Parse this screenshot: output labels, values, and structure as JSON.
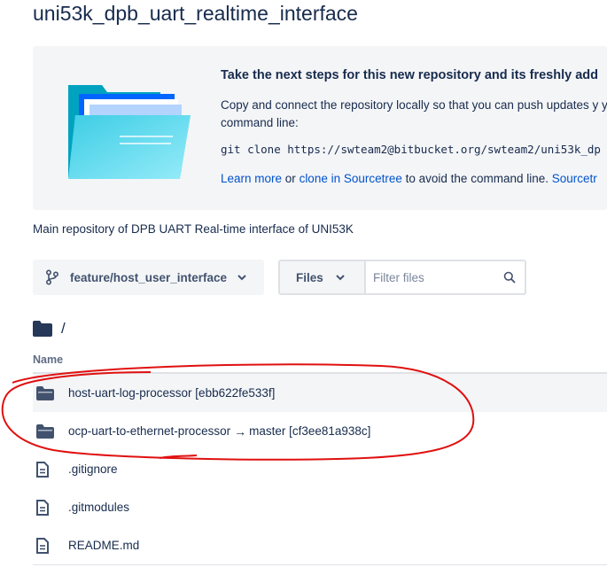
{
  "repo": {
    "title": "uni53k_dpb_uart_realtime_interface",
    "description": "Main repository of DPB UART Real-time interface of UNI53K"
  },
  "onboarding": {
    "heading": "Take the next steps for this new repository and its freshly add",
    "description": "Copy and connect the repository locally so that you can push updates y your command line:",
    "clone_command": "git clone https://swteam2@bitbucket.org/swteam2/uni53k_dp",
    "learn_more": "Learn more",
    "or_text": " or ",
    "clone_in_sourcetree": "clone in Sourcetree",
    "avoid_text": " to avoid the command line. ",
    "sourcetree": "Sourcetr"
  },
  "branch": {
    "label": "feature/host_user_interface"
  },
  "filter": {
    "mode_label": "Files",
    "placeholder": "Filter files"
  },
  "path": {
    "label": "/"
  },
  "table": {
    "name_header": "Name",
    "rows": [
      {
        "type": "folder",
        "name": "host-uart-log-processor [ebb622fe533f]",
        "target": ""
      },
      {
        "type": "folder",
        "name": "ocp-uart-to-ethernet-processor",
        "arrow": "→",
        "target": "master [cf3ee81a938c]"
      },
      {
        "type": "file",
        "name": ".gitignore",
        "target": ""
      },
      {
        "type": "file",
        "name": ".gitmodules",
        "target": ""
      },
      {
        "type": "file",
        "name": "README.md",
        "target": ""
      }
    ]
  },
  "colors": {
    "text": "#172b4d",
    "link": "#0052cc",
    "panel": "#f4f5f7",
    "annotation": "#e01010"
  },
  "icons": {
    "branch": "branch-icon",
    "chevron": "chevron-down-icon",
    "search": "search-icon",
    "folder": "folder-icon",
    "file": "file-icon"
  }
}
